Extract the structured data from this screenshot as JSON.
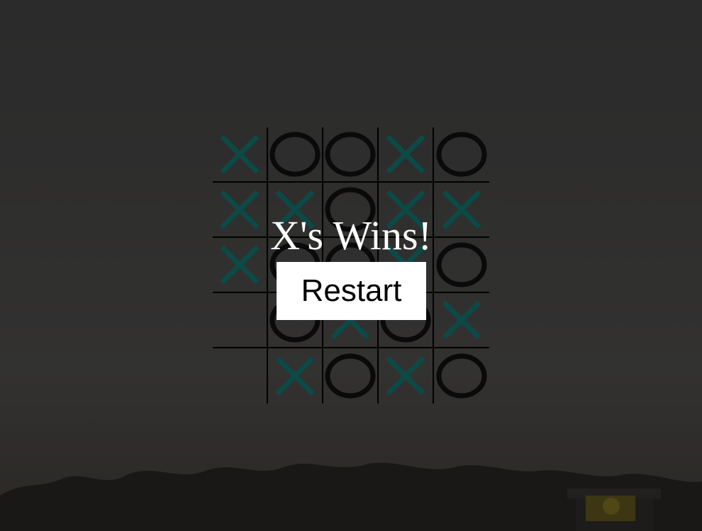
{
  "game": {
    "board": [
      [
        "X",
        "O",
        "O",
        "X",
        "O"
      ],
      [
        "X",
        "X",
        "O",
        "X",
        "X"
      ],
      [
        "X",
        "O",
        "O",
        "X",
        "O"
      ],
      [
        "",
        "O",
        "X",
        "O",
        "X"
      ],
      [
        "",
        "X",
        "O",
        "X",
        "O"
      ]
    ]
  },
  "result": {
    "message": "X's Wins!"
  },
  "controls": {
    "restart_label": "Restart"
  },
  "colors": {
    "x": "#0b4a46",
    "o": "#0a0a0a",
    "line": "#000000",
    "button_bg": "#ffffff"
  },
  "icons": {
    "x": "x-mark-icon",
    "o": "o-mark-icon"
  }
}
